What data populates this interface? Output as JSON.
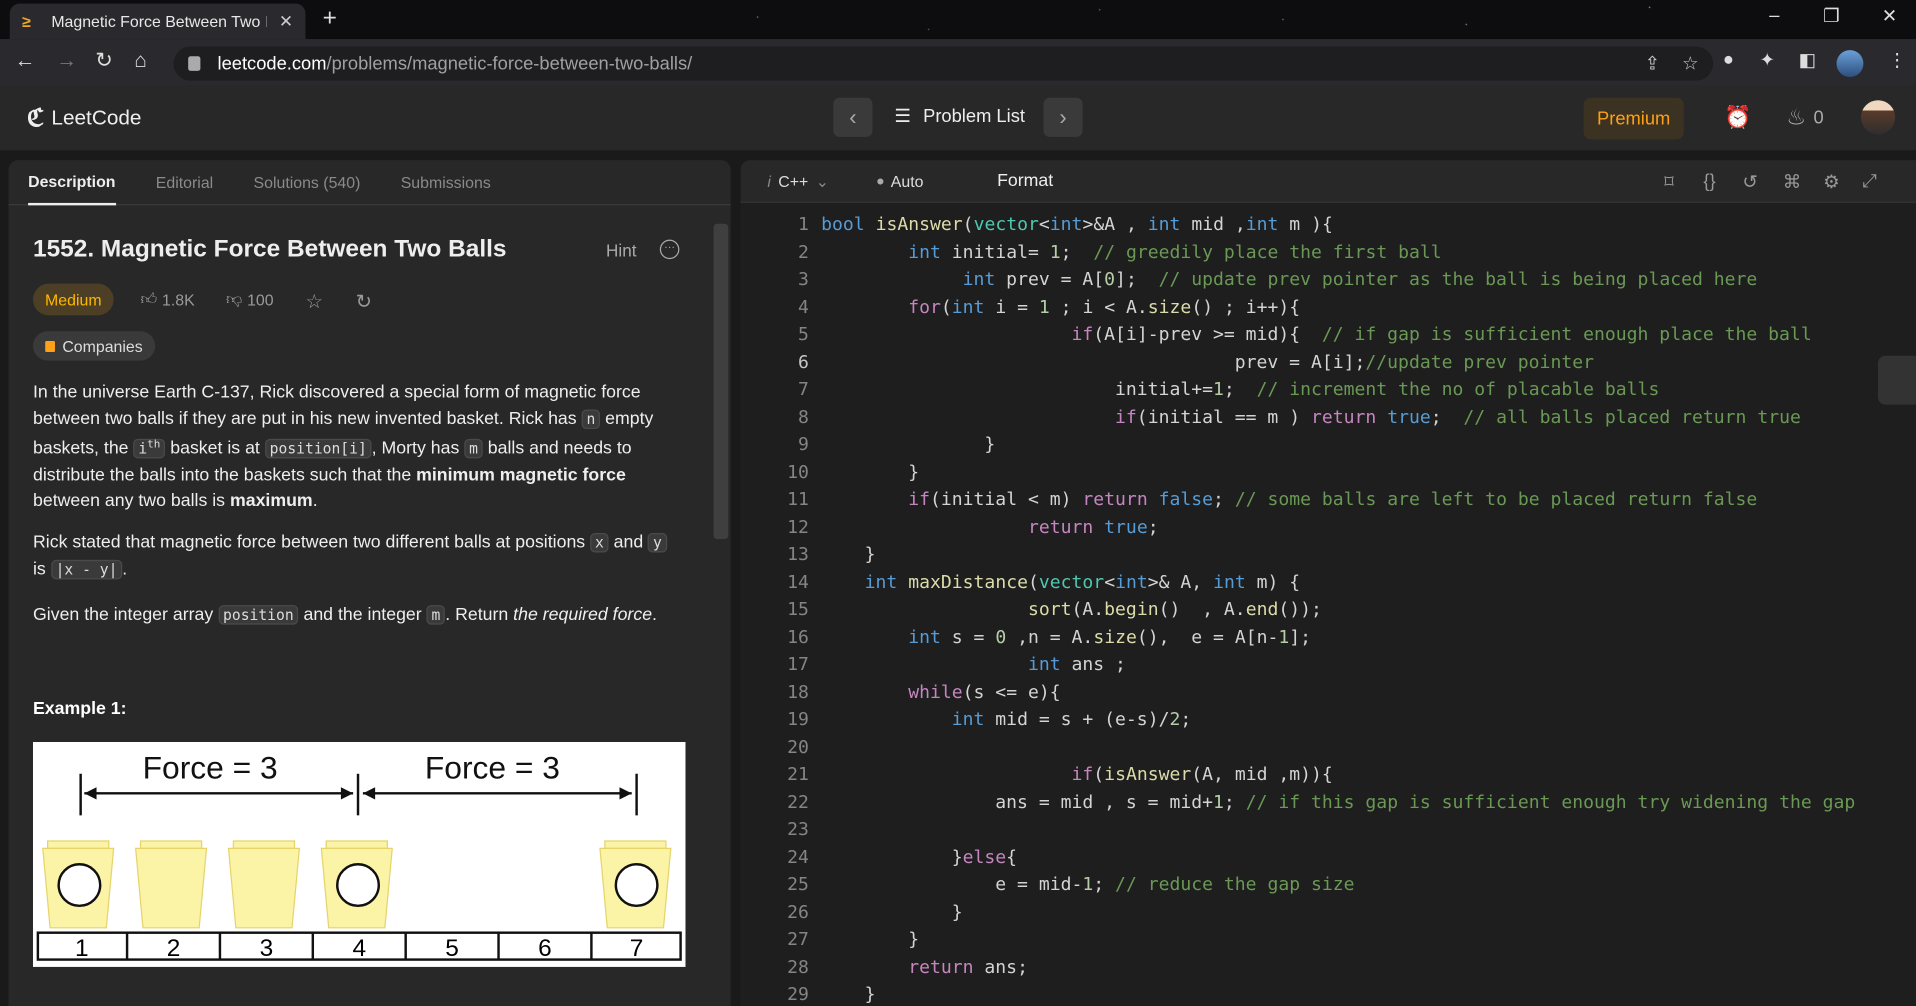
{
  "browser": {
    "tab_title": "Magnetic Force Between Two Bal",
    "url_host": "leetcode.com",
    "url_path": "/problems/magnetic-force-between-two-balls/"
  },
  "header": {
    "logo": "LeetCode",
    "problem_list": "Problem List",
    "premium": "Premium",
    "streak_count": "0"
  },
  "left": {
    "tabs": [
      "Description",
      "Editorial",
      "Solutions (540)",
      "Submissions"
    ],
    "title": "1552. Magnetic Force Between Two Balls",
    "hint": "Hint",
    "difficulty": "Medium",
    "likes": "1.8K",
    "dislikes": "100",
    "companies": "Companies",
    "p1_a": "In the universe Earth C-137, Rick discovered a special form of magnetic force between two balls if they are put in his new invented basket. Rick has ",
    "p1_n": "n",
    "p1_b": " empty baskets, the ",
    "p1_i": "i",
    "p1_th": "th",
    "p1_c": " basket is at ",
    "p1_pos": "position[i]",
    "p1_d": ", Morty has ",
    "p1_m": "m",
    "p1_e": " balls and needs to distribute the balls into the baskets such that the ",
    "p1_bold1": "minimum magnetic force",
    "p1_f": " between any two balls is ",
    "p1_bold2": "maximum",
    "p1_g": ".",
    "p2_a": "Rick stated that magnetic force between two different balls at positions ",
    "p2_x": "x",
    "p2_and": " and ",
    "p2_y": "y",
    "p2_is": " is ",
    "p2_abs": "|x - y|",
    "p2_end": ".",
    "p3_a": "Given the integer array ",
    "p3_pos": "position",
    "p3_b": " and the integer ",
    "p3_m": "m",
    "p3_c": ". Return ",
    "p3_it": "the required force",
    "p3_d": ".",
    "example_title": "Example 1:",
    "diagram": {
      "force_left": "Force = 3",
      "force_right": "Force = 3",
      "positions": [
        "1",
        "2",
        "3",
        "4",
        "5",
        "6",
        "7"
      ]
    }
  },
  "editor": {
    "language": "C++",
    "mode": "Auto",
    "format": "Format",
    "current_line": 6
  }
}
